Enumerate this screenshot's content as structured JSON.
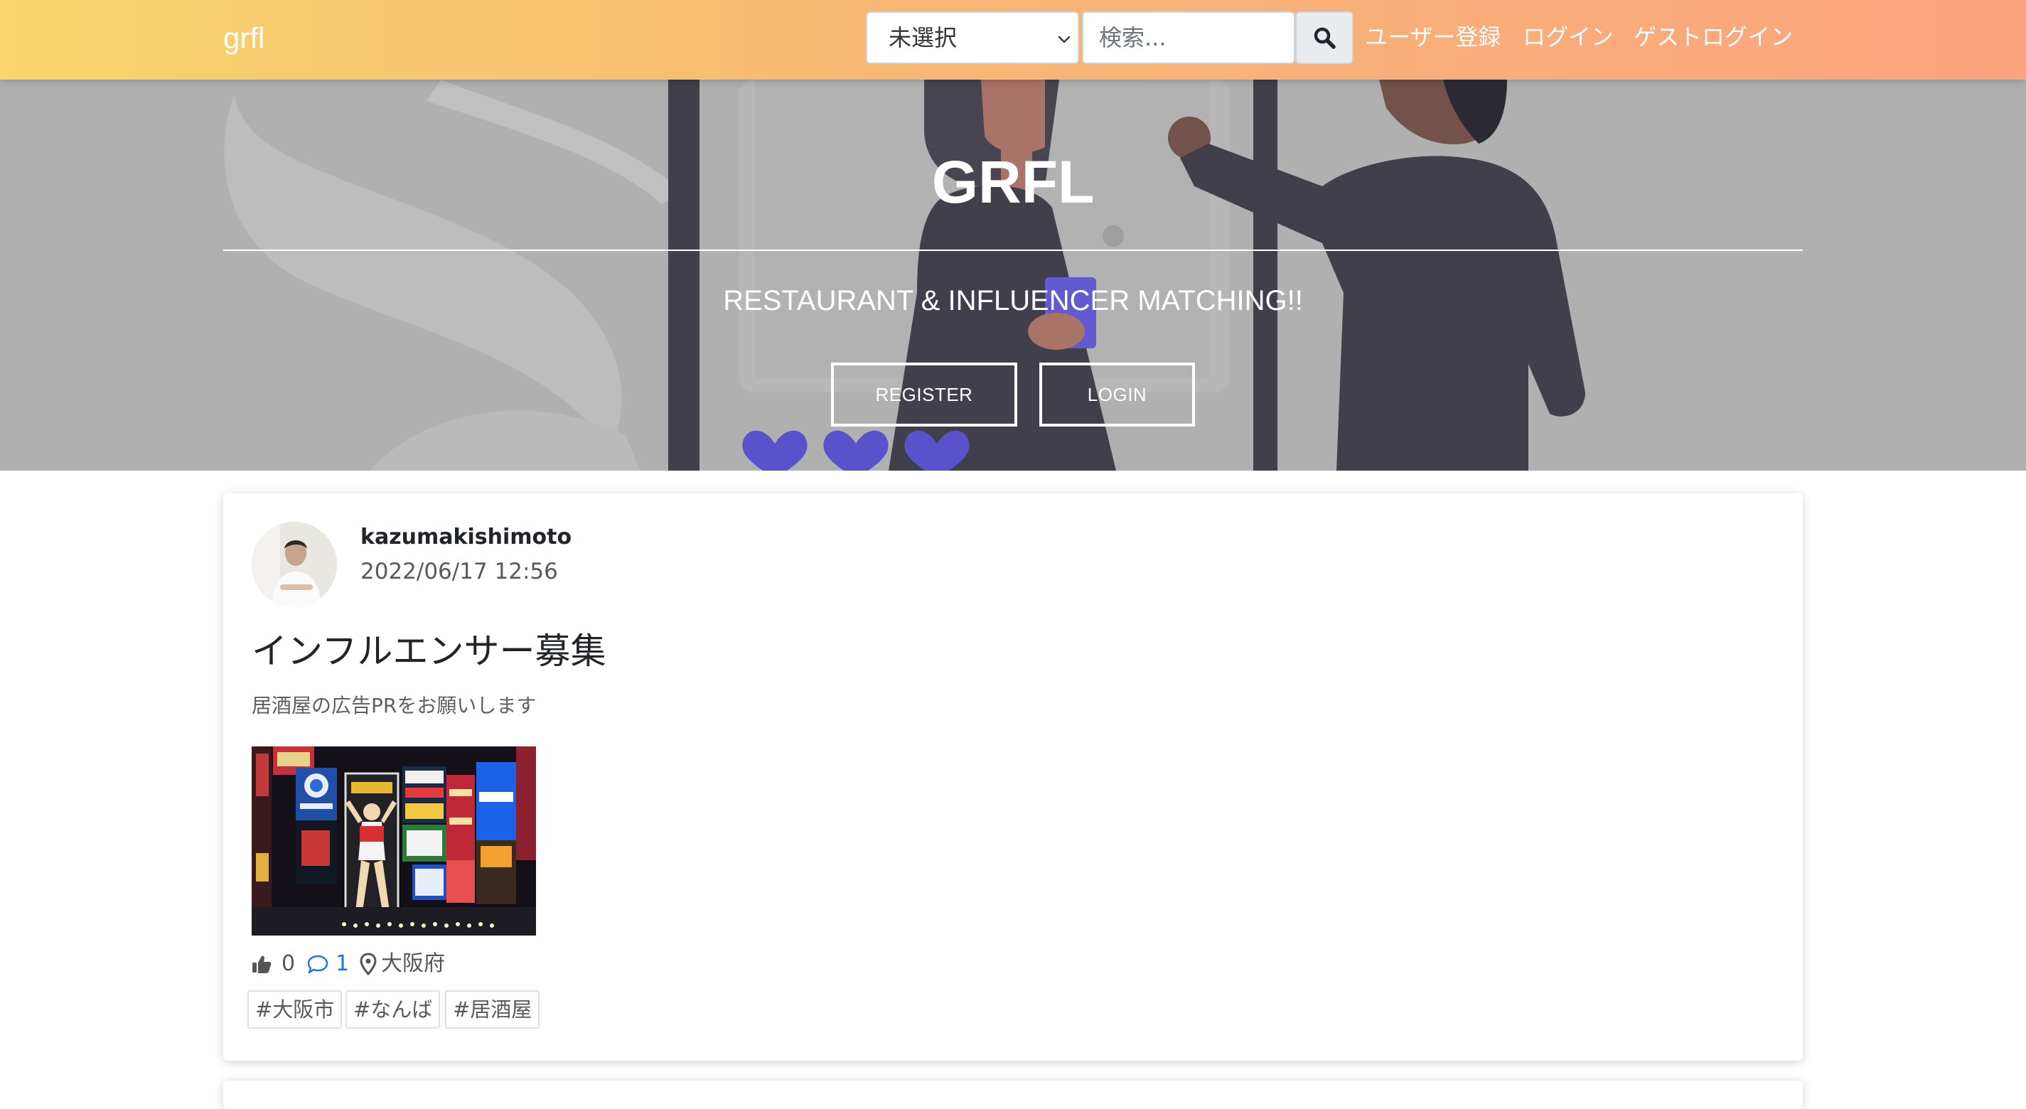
{
  "navbar": {
    "brand": "grfl",
    "category_select": {
      "selected": "未選択"
    },
    "search": {
      "placeholder": "検索..."
    },
    "links": {
      "register": "ユーザー登録",
      "login": "ログイン",
      "guest_login": "ゲストログイン"
    }
  },
  "hero": {
    "title": "GRFL",
    "subtitle": "RESTAURANT & INFLUENCER MATCHING!!",
    "register_label": "REGISTER",
    "login_label": "LOGIN"
  },
  "post": {
    "username": "kazumakishimoto",
    "timestamp": "2022/06/17 12:56",
    "title": "インフルエンサー募集",
    "description": "居酒屋の広告PRをお願いします",
    "likes": "0",
    "comments": "1",
    "location": "大阪府",
    "tags": [
      "#大阪市",
      "#なんば",
      "#居酒屋"
    ]
  },
  "colors": {
    "nav_gradient_start": "#f9d56c",
    "nav_gradient_end": "#fca37f",
    "hero_background": "#acacac",
    "comment_accent": "#1a73e8"
  }
}
